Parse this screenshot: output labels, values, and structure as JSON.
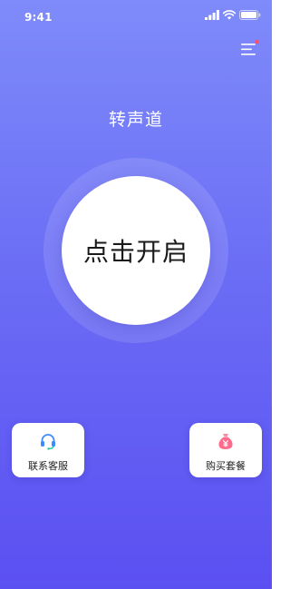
{
  "status_bar": {
    "time": "9:41",
    "icons": [
      "signal-icon",
      "wifi-icon",
      "battery-icon"
    ]
  },
  "header": {
    "menu_icon": "menu-icon",
    "has_notification_dot": true,
    "title": "转声道"
  },
  "main": {
    "start_button_label": "点击开启"
  },
  "actions": {
    "service": {
      "label": "联系客服",
      "icon": "headset-icon"
    },
    "buy": {
      "label": "购买套餐",
      "icon": "money-bag-icon"
    }
  },
  "colors": {
    "background_top": "#7f8bfa",
    "background_bottom": "#5b4ff2",
    "accent_blue": "#3d8bff",
    "accent_pink": "#ff6b8a",
    "notification_dot": "#ff4d6d"
  }
}
